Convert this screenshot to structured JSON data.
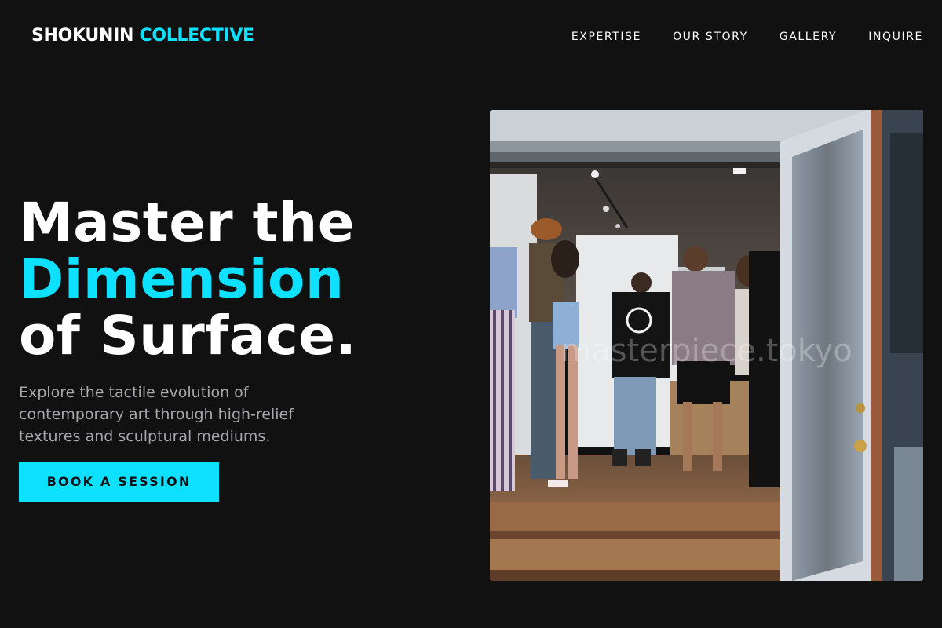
{
  "brand": {
    "name_primary": "SHOKUNIN",
    "name_accent": "COLLECTIVE"
  },
  "nav": {
    "items": [
      "EXPERTISE",
      "OUR STORY",
      "GALLERY",
      "INQUIRE"
    ]
  },
  "hero": {
    "headline_line1": "Master the",
    "headline_line2": "Dimension",
    "headline_line3": "of Surface.",
    "subtext": "Explore the tactile evolution of contemporary art through high-relief textures and sculptural mediums.",
    "cta_label": "BOOK A SESSION"
  },
  "photo": {
    "watermark": "masterpiece.tokyo"
  },
  "colors": {
    "accent": "#0ee0ff",
    "background": "#111112",
    "muted_text": "#a8a8ac"
  }
}
